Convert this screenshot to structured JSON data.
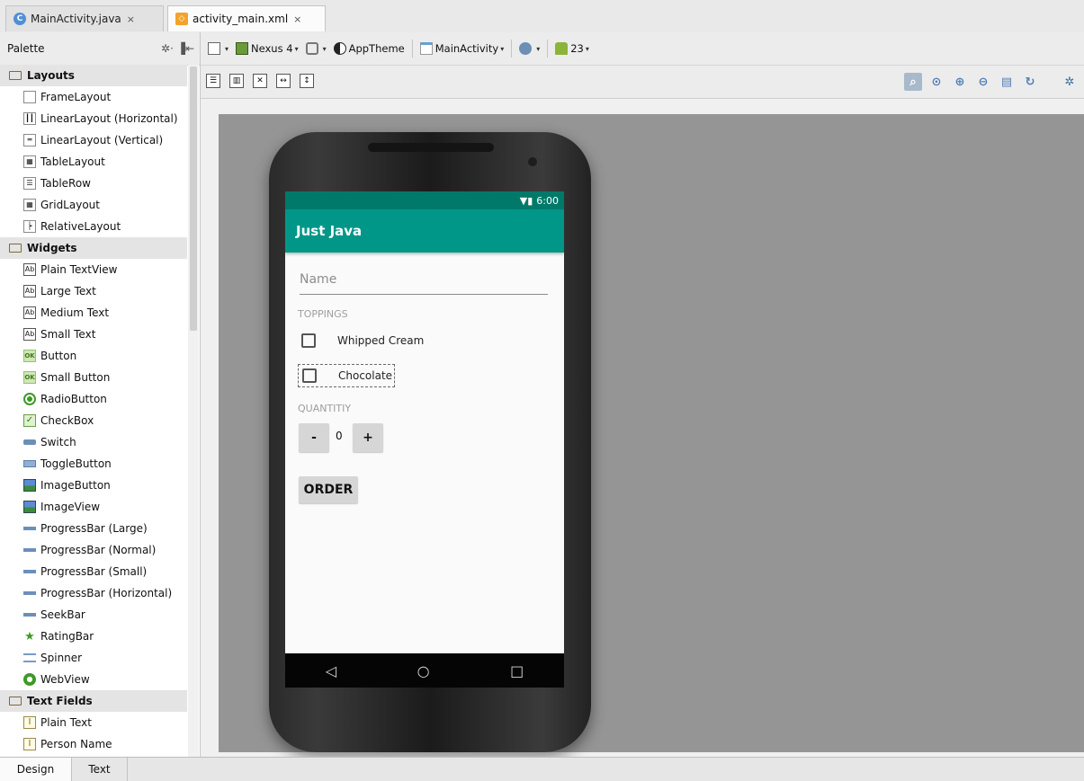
{
  "tabs": [
    {
      "icon": "C",
      "label": "MainActivity.java",
      "close": "×"
    },
    {
      "icon": "xml",
      "label": "activity_main.xml",
      "close": "×"
    }
  ],
  "palette": {
    "title": "Palette",
    "tools": "✲· ▐⇤",
    "sections": [
      {
        "title": "Layouts",
        "items": [
          "FrameLayout",
          "LinearLayout (Horizontal)",
          "LinearLayout (Vertical)",
          "TableLayout",
          "TableRow",
          "GridLayout",
          "RelativeLayout"
        ]
      },
      {
        "title": "Widgets",
        "items": [
          "Plain TextView",
          "Large Text",
          "Medium Text",
          "Small Text",
          "Button",
          "Small Button",
          "RadioButton",
          "CheckBox",
          "Switch",
          "ToggleButton",
          "ImageButton",
          "ImageView",
          "ProgressBar (Large)",
          "ProgressBar (Normal)",
          "ProgressBar (Small)",
          "ProgressBar (Horizontal)",
          "SeekBar",
          "RatingBar",
          "Spinner",
          "WebView"
        ]
      },
      {
        "title": "Text Fields",
        "items": [
          "Plain Text",
          "Person Name"
        ]
      }
    ]
  },
  "toolbar": {
    "device": "Nexus 4",
    "theme": "AppTheme",
    "activity": "MainActivity",
    "api": "23"
  },
  "preview": {
    "status_time": "6:00",
    "app_title": "Just Java",
    "name_hint": "Name",
    "toppings_label": "TOPPINGS",
    "topping1": "Whipped Cream",
    "topping2": "Chocolate",
    "quantity_label": "QUANTITIY",
    "minus": "-",
    "quantity": "0",
    "plus": "+",
    "order": "ORDER",
    "nav_back": "◁",
    "nav_home": "○",
    "nav_recent": "□"
  },
  "bottom_tabs": {
    "design": "Design",
    "text": "Text"
  }
}
